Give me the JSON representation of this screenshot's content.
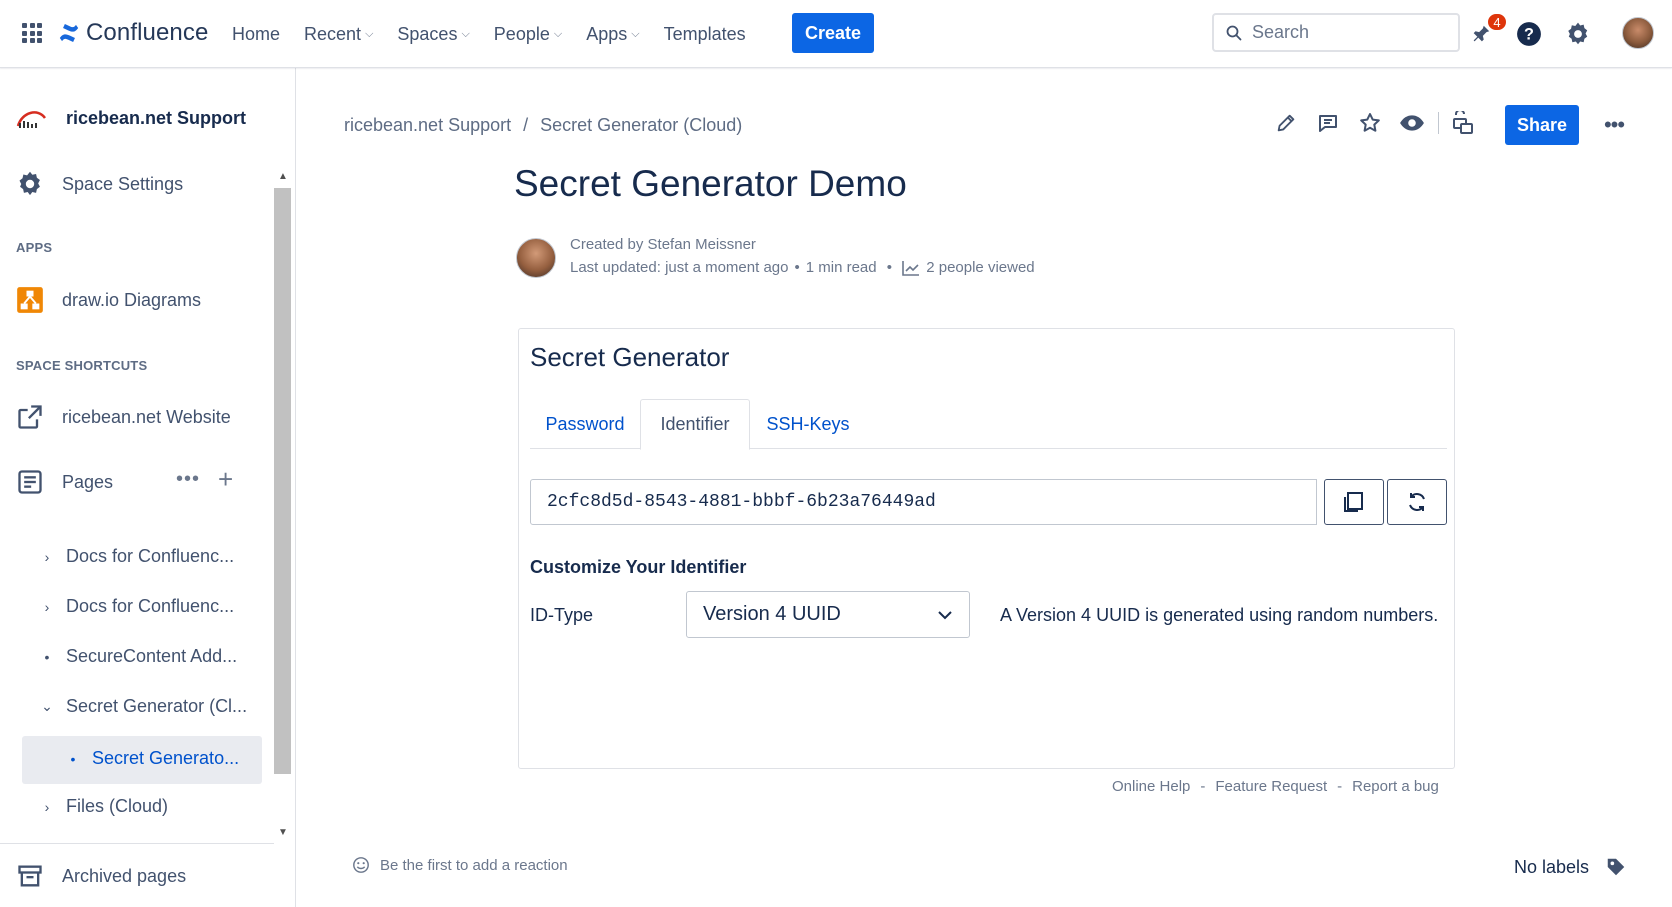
{
  "topnav": {
    "product": "Confluence",
    "items": [
      {
        "label": "Home",
        "dropdown": false
      },
      {
        "label": "Recent",
        "dropdown": true
      },
      {
        "label": "Spaces",
        "dropdown": true
      },
      {
        "label": "People",
        "dropdown": true
      },
      {
        "label": "Apps",
        "dropdown": true
      },
      {
        "label": "Templates",
        "dropdown": false
      }
    ],
    "create_label": "Create",
    "search_placeholder": "Search",
    "notification_count": "4"
  },
  "sidebar": {
    "space_name": "ricebean.net Support",
    "space_settings": "Space Settings",
    "apps_heading": "APPS",
    "apps": [
      {
        "label": "draw.io Diagrams"
      }
    ],
    "shortcuts_heading": "SPACE SHORTCUTS",
    "shortcuts": [
      {
        "label": "ricebean.net Website"
      }
    ],
    "pages_label": "Pages",
    "tree": [
      {
        "label": "Docs for Confluenc...",
        "twisty": "›"
      },
      {
        "label": "Docs for Confluenc...",
        "twisty": "›"
      },
      {
        "label": "SecureContent Add...",
        "twisty": "•"
      },
      {
        "label": "Secret Generator (Cl...",
        "twisty": "⌄"
      },
      {
        "label": "Secret Generato...",
        "twisty": "•",
        "active": true
      },
      {
        "label": "Files (Cloud)",
        "twisty": "›"
      }
    ],
    "archived_label": "Archived pages"
  },
  "breadcrumb": {
    "space": "ricebean.net Support",
    "separator": "/",
    "parent": "Secret Generator (Cloud)"
  },
  "page_actions": {
    "share_label": "Share"
  },
  "page": {
    "title": "Secret Generator Demo",
    "created_by": "Created by Stefan Meissner",
    "last_updated": "Last updated: just a moment ago",
    "read_time": "1 min read",
    "views": "2 people viewed"
  },
  "macro": {
    "title": "Secret Generator",
    "tabs": [
      {
        "label": "Password",
        "active": false
      },
      {
        "label": "Identifier",
        "active": true
      },
      {
        "label": "SSH-Keys",
        "active": false
      }
    ],
    "identifier_value": "2cfc8d5d-8543-4881-bbbf-6b23a76449ad",
    "customize_title": "Customize Your Identifier",
    "id_type_label": "ID-Type",
    "id_type_selected": "Version 4 UUID",
    "id_type_description": "A Version 4 UUID is generated using random numbers."
  },
  "help_links": {
    "online_help": "Online Help",
    "feature_request": "Feature Request",
    "report_bug": "Report a bug",
    "separator": "-"
  },
  "footer": {
    "reaction_label": "Be the first to add a reaction",
    "labels_text": "No labels"
  },
  "colors": {
    "brand_blue": "#0c66e4",
    "link_blue": "#0052cc",
    "badge_red": "#de350b",
    "text_primary": "#172b4d",
    "text_subtle": "#6b778c"
  },
  "icons": [
    "app-switcher-icon",
    "confluence-logo-icon",
    "search-icon",
    "notification-icon",
    "help-icon",
    "settings-icon",
    "edit-icon",
    "comment-icon",
    "star-icon",
    "watch-icon",
    "restrictions-icon",
    "copy-icon",
    "refresh-icon",
    "chevron-down-icon",
    "analytics-icon",
    "emoji-icon",
    "label-icon"
  ]
}
